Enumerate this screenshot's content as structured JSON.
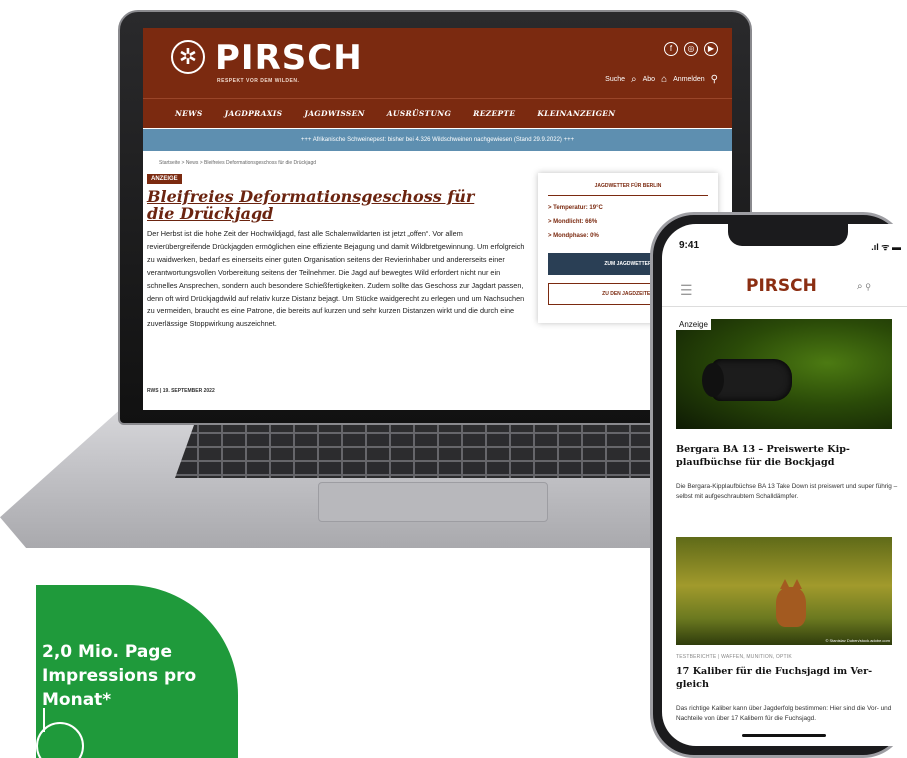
{
  "desktop_site": {
    "logo": "PIRSCH",
    "tagline": "RESPEKT VOR DEM WILDEN.",
    "header_actions": [
      "Suche",
      "Abo",
      "Anmelden"
    ],
    "nav": [
      "NEWS",
      "JAGDPRAXIS",
      "JAGDWISSEN",
      "AUSRÜSTUNG",
      "REZEPTE",
      "KLEINANZEIGEN"
    ],
    "ticker": "+++ Afrikanische Schweinepest: bisher bei 4.326 Wildschweinen nachgewiesen (Stand 29.9.2022) +++",
    "breadcrumb": "Startseite  >  News  >  Bleifreies Deformationsgeschoss für die Drückjagd",
    "ad_label": "ANZEIGE",
    "article_title": "Bleifreies Deformationsgeschoss für die Drückjagd",
    "article_body": "Der Herbst ist die hohe Zeit der Hochwildjagd, fast alle Schalenwildarten ist jetzt „offen“. Vor allem revierübergreifende Drückjagden ermöglichen eine effiziente Bejagung und damit Wildbretgewinnung. Um erfolgreich zu waidwerken, bedarf es einerseits einer guten Organisation seitens der Revierinhaber und andererseits einer verantwortungsvollen Vorbereitung seitens der Teilnehmer. Die Jagd auf bewegtes Wild erfordert nicht nur ein schnelles Ansprechen, sondern auch besondere Schießfertigkeiten. Zudem sollte das Geschoss zur Jagdart passen, denn oft wird Drückjagdwild auf relativ kurze Distanz bejagt. Um Stücke waidgerecht zu erlegen und um Nachsuchen zu vermeiden, braucht es eine Patrone, die bereits auf kurzen und sehr kurzen Distanzen wirkt und die durch eine zuverlässige Stoppwirkung auszeichnet.",
    "byline": "RWS  |  19. SEPTEMBER 2022",
    "weather": {
      "title": "JAGDWETTER FÜR BERLIN",
      "items": [
        "> Temperatur: 19°C",
        "> Mondlicht: 66%",
        "> Mondphase: 0%"
      ],
      "button_primary": "ZUM JAGDWETTER",
      "button_secondary": "ZU DEN JAGDZEITEN"
    }
  },
  "mobile_site": {
    "time": "9:41",
    "status": ".ıl ᯤ ▬",
    "logo": "PIRSCH",
    "card1": {
      "badge": "Anzeige",
      "title": "Bergara BA 13 – Preiswerte Kip-plaufbüchse für die Bockjagd",
      "text": "Die Bergara-Kipplaufbüchse BA 13 Take Down ist preiswert und super führig – selbst mit aufgeschraubtem Schalldämpfer."
    },
    "card2": {
      "credit": "© Stanislav Duben/stock.adobe.com",
      "tags": "TESTBERICHTE | WAFFEN, MUNITION, OPTIK",
      "title": "17 Kaliber für die Fuchsjagd im Ver-gleich",
      "text": "Das richtige Kaliber kann über Jagderfolg bestimmen: Hier sind die Vor- und Nachteile von über 17 Kalibern für die Fuchsjagd."
    }
  },
  "stat": {
    "text": "2,0 Mio. Page Impressions pro Monat*"
  },
  "colors": {
    "brand": "#7b2a10",
    "ticker": "#5e8fb0",
    "stat_green": "#1f9a3b"
  }
}
